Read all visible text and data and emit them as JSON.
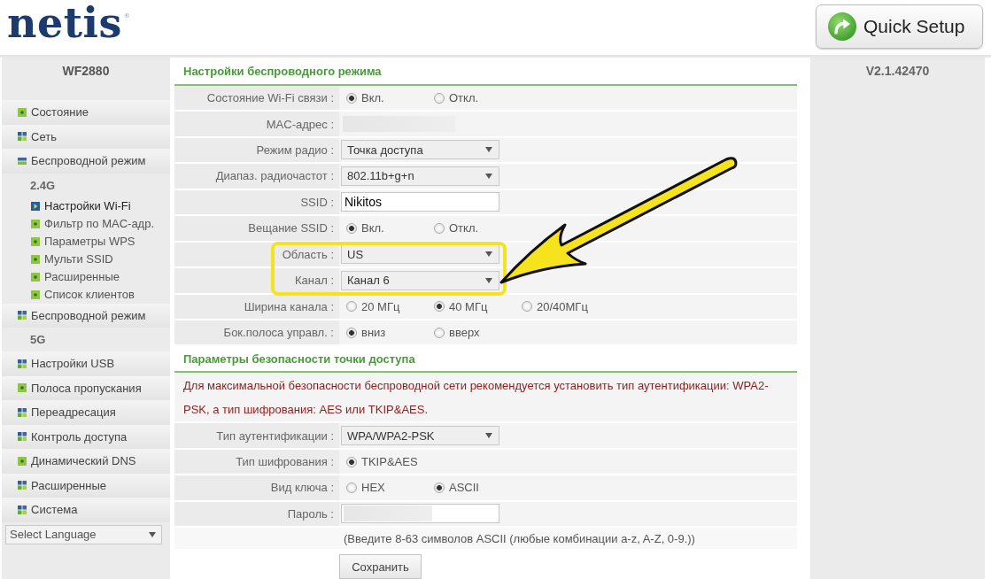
{
  "header": {
    "logo": "netis",
    "logo_mark": "®",
    "quick_setup": "Quick Setup"
  },
  "sidebar": {
    "model": "WF2880",
    "items": [
      {
        "label": "Состояние",
        "kind": "page",
        "selected": false
      },
      {
        "label": "Сеть",
        "kind": "group",
        "expanded": false,
        "selected": false
      },
      {
        "label": "Беспроводной режим",
        "kind": "group",
        "expanded": true,
        "selected": false,
        "band": "2.4G",
        "children": [
          {
            "label": "Настройки Wi-Fi",
            "selected": true
          },
          {
            "label": "Фильтр по MAC-адр.",
            "selected": false
          },
          {
            "label": "Параметры WPS",
            "selected": false
          },
          {
            "label": "Мульти SSID",
            "selected": false
          },
          {
            "label": "Расширенные",
            "selected": false
          },
          {
            "label": "Список клиентов",
            "selected": false
          }
        ]
      },
      {
        "label": "Беспроводной режим",
        "kind": "group",
        "expanded": false,
        "selected": false,
        "band": "5G"
      },
      {
        "label": "Настройки USB",
        "kind": "group",
        "expanded": false,
        "selected": false
      },
      {
        "label": "Полоса пропускания",
        "kind": "page",
        "selected": false
      },
      {
        "label": "Переадресация",
        "kind": "group",
        "expanded": false,
        "selected": false
      },
      {
        "label": "Контроль доступа",
        "kind": "group",
        "expanded": false,
        "selected": false
      },
      {
        "label": "Динамический DNS",
        "kind": "page",
        "selected": false
      },
      {
        "label": "Расширенные",
        "kind": "group",
        "expanded": false,
        "selected": false
      },
      {
        "label": "Система",
        "kind": "group",
        "expanded": false,
        "selected": false
      }
    ],
    "language": {
      "value": "Select Language"
    }
  },
  "sections": [
    {
      "title": "Настройки беспроводного режима",
      "rows": [
        {
          "label": "Состояние Wi-Fi связи :",
          "kind": "radio",
          "highlighted": false,
          "options": [
            {
              "label": "Вкл.",
              "selected": true
            },
            {
              "label": "Откл.",
              "selected": false
            }
          ]
        },
        {
          "label": "MAC-адрес :",
          "kind": "redacted",
          "highlighted": false
        },
        {
          "label": "Режим радио :",
          "kind": "select",
          "highlighted": false,
          "value": "Точка доступа"
        },
        {
          "label": "Диапаз. радиочастот :",
          "kind": "select",
          "highlighted": false,
          "value": "802.11b+g+n"
        },
        {
          "label": "SSID :",
          "kind": "text",
          "highlighted": false,
          "value": "Nikitos"
        },
        {
          "label": "Вещание SSID :",
          "kind": "radio",
          "highlighted": false,
          "options": [
            {
              "label": "Вкл.",
              "selected": true
            },
            {
              "label": "Откл.",
              "selected": false
            }
          ]
        },
        {
          "label": "Область :",
          "kind": "select",
          "highlighted": true,
          "value": "US"
        },
        {
          "label": "Канал :",
          "kind": "select",
          "highlighted": true,
          "value": "Канал 6"
        },
        {
          "label": "Ширина канала :",
          "kind": "radio",
          "highlighted": false,
          "options": [
            {
              "label": "20 МГц",
              "selected": false
            },
            {
              "label": "40 МГц",
              "selected": true
            },
            {
              "label": "20/40МГц",
              "selected": false
            }
          ]
        },
        {
          "label": "Бок.полоса управл. :",
          "kind": "radio",
          "highlighted": false,
          "options": [
            {
              "label": "вниз",
              "selected": true
            },
            {
              "label": "вверх",
              "selected": false
            }
          ]
        }
      ]
    },
    {
      "title": "Параметры безопасности точки доступа",
      "notice": "Для максимальной безопасности беспроводной сети рекомендуется установить тип аутентификации: WPA2-PSK, а тип шифрования: AES или TKIP&AES.",
      "rows": [
        {
          "label": "Тип аутентификации :",
          "kind": "select",
          "highlighted": false,
          "value": "WPA/WPA2-PSK"
        },
        {
          "label": "Тип шифрования :",
          "kind": "radio",
          "highlighted": false,
          "options": [
            {
              "label": "TKIP&AES",
              "selected": true
            }
          ]
        },
        {
          "label": "Вид ключа :",
          "kind": "radio",
          "highlighted": false,
          "options": [
            {
              "label": "HEX",
              "selected": false
            },
            {
              "label": "ASCII",
              "selected": true
            }
          ]
        },
        {
          "label": "Пароль :",
          "kind": "password",
          "highlighted": false
        }
      ],
      "hint": "(Введите 8-63 символов ASCII (любые комбинации a-z, A-Z, 0-9.))",
      "button": "Сохранить"
    }
  ],
  "version": "V2.1.42470"
}
